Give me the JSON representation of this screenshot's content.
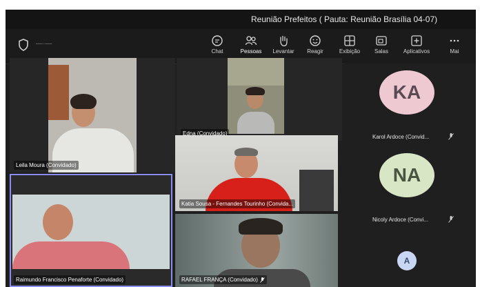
{
  "window": {
    "title": "Reunião Prefeitos ( Pauta: Reunião Brasília 04-07)"
  },
  "toolbar": {
    "items": [
      {
        "label": "Chat",
        "icon": "chat-icon"
      },
      {
        "label": "Pessoas",
        "icon": "people-icon"
      },
      {
        "label": "Levantar",
        "icon": "raise-hand-icon"
      },
      {
        "label": "Reagir",
        "icon": "smile-icon"
      },
      {
        "label": "Exibição",
        "icon": "view-grid-icon"
      },
      {
        "label": "Salas",
        "icon": "rooms-icon"
      },
      {
        "label": "Aplicativos",
        "icon": "add-app-icon"
      },
      {
        "label": "Mais",
        "icon": "more-icon",
        "display": "Mai"
      }
    ],
    "active": "Pessoas"
  },
  "participants": [
    {
      "name": "Leila Moura (Convidado)"
    },
    {
      "name": "Edna (Convidado)"
    },
    {
      "name": "Katia Sousa - Fernandes Tourinho (Convida..."
    },
    {
      "name": "Raimundo Francisco Penaforte (Convidado)"
    },
    {
      "name": "RAFAEL FRANÇA (Convidado)"
    }
  ],
  "roster": [
    {
      "initials": "KA",
      "name": "Karol Ardoce (Convid...",
      "avatar_color": "#efc9d2"
    },
    {
      "initials": "NA",
      "name": "Nicoly Ardoce (Convi...",
      "avatar_color": "#d9e6c5"
    },
    {
      "initials": "A",
      "name": "",
      "avatar_color": "#c9d6f3"
    }
  ],
  "colors": {
    "accent": "#8b8cf2",
    "background": "#1f1f1f"
  }
}
